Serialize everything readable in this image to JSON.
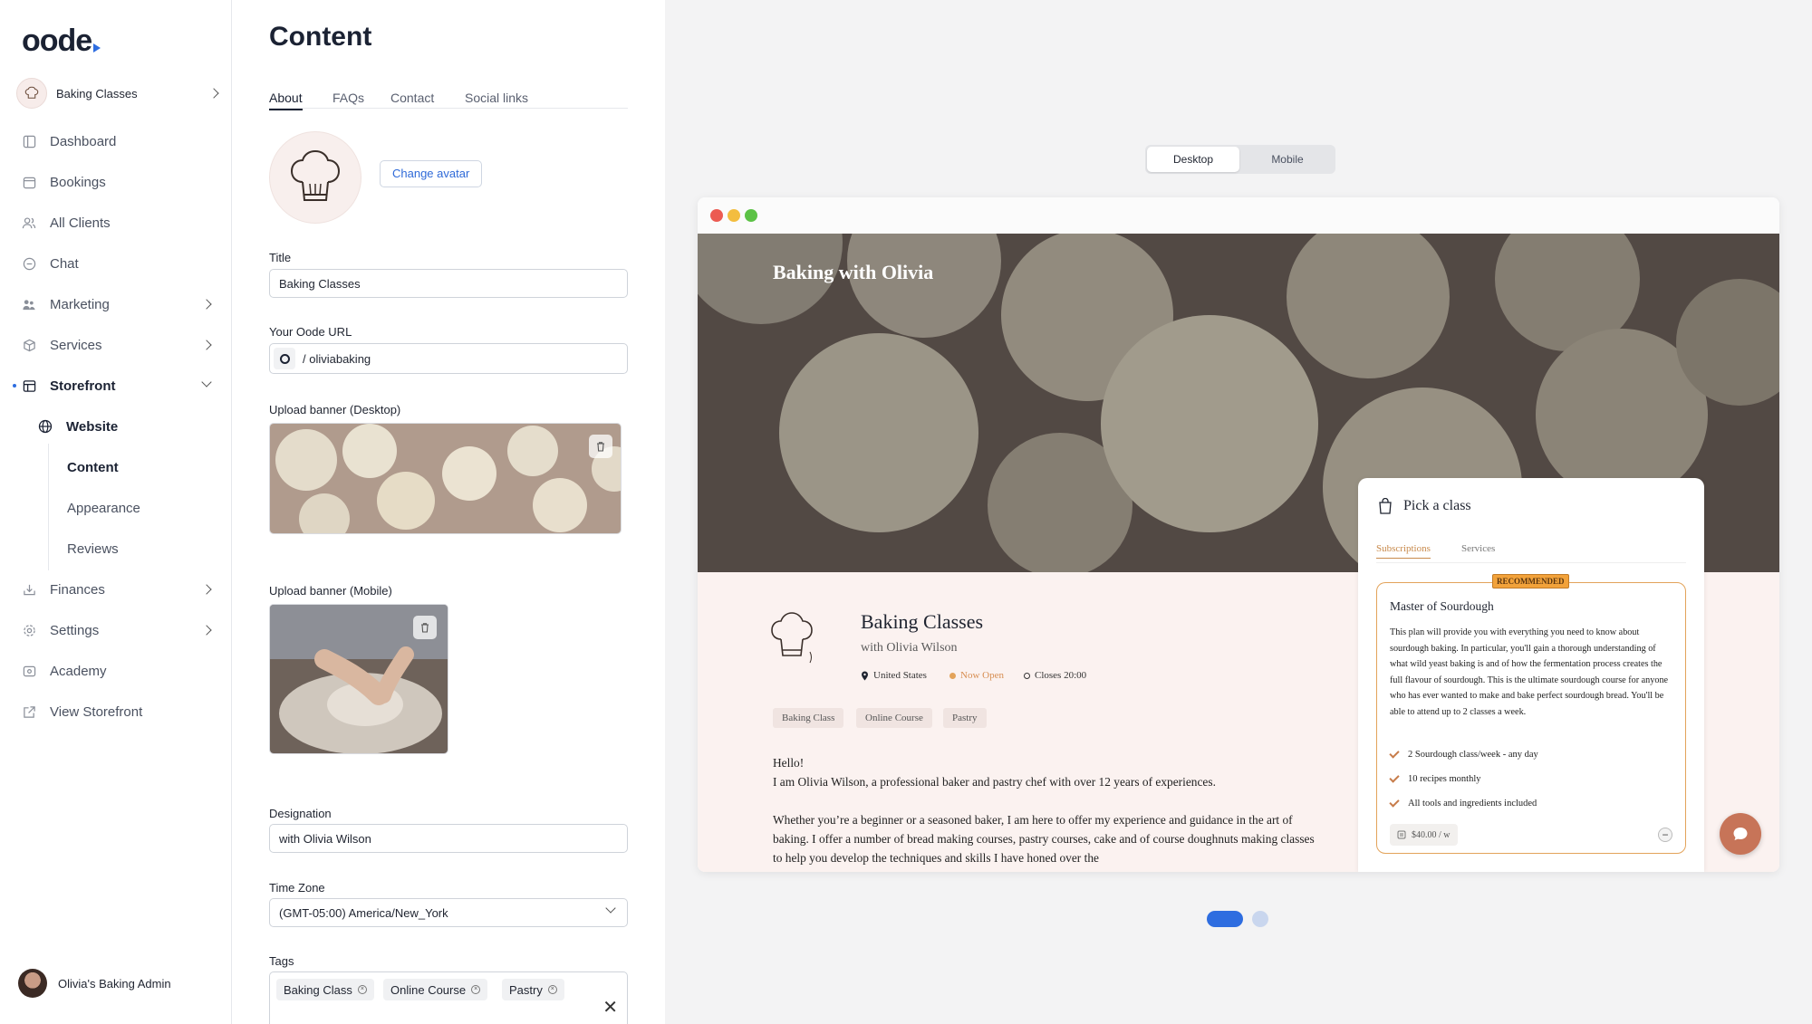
{
  "brand": {
    "logo_text": "oode",
    "accent": "#2e6de0"
  },
  "sidebar": {
    "business_name": "Baking Classes",
    "items": [
      {
        "label": "Dashboard",
        "icon": "dashboard-icon"
      },
      {
        "label": "Bookings",
        "icon": "calendar-icon"
      },
      {
        "label": "All Clients",
        "icon": "users-icon"
      },
      {
        "label": "Chat",
        "icon": "chat-icon"
      },
      {
        "label": "Marketing",
        "icon": "megaphone-icon"
      },
      {
        "label": "Services",
        "icon": "box-icon"
      },
      {
        "label": "Storefront",
        "icon": "storefront-icon"
      },
      {
        "label": "Finances",
        "icon": "wallet-icon"
      },
      {
        "label": "Settings",
        "icon": "gear-icon"
      },
      {
        "label": "Academy",
        "icon": "academy-icon"
      },
      {
        "label": "View Storefront",
        "icon": "external-link-icon"
      }
    ],
    "storefront_sub": {
      "website": "Website",
      "content": "Content",
      "appearance": "Appearance",
      "reviews": "Reviews"
    },
    "admin_name": "Olivia's Baking Admin"
  },
  "editor": {
    "title": "Content",
    "tabs": [
      "About",
      "FAQs",
      "Contact",
      "Social links"
    ],
    "change_avatar": "Change avatar",
    "title_label": "Title",
    "title_value": "Baking Classes",
    "url_label": "Your Oode URL",
    "url_value": "/ oliviabaking",
    "banner_desktop_label": "Upload banner (Desktop)",
    "banner_mobile_label": "Upload banner (Mobile)",
    "designation_label": "Designation",
    "designation_value": "with Olivia Wilson",
    "timezone_label": "Time Zone",
    "timezone_value": "(GMT-05:00) America/New_York",
    "tags_label": "Tags",
    "tags": [
      "Baking Class",
      "Online Course",
      "Pastry"
    ]
  },
  "preview": {
    "toggle": [
      "Desktop",
      "Mobile"
    ],
    "hero_title": "Baking with Olivia",
    "biz_title": "Baking Classes",
    "biz_sub": "with Olivia Wilson",
    "location": "United States",
    "status": "Now Open",
    "closes": "Closes 20:00",
    "tags": [
      "Baking Class",
      "Online Course",
      "Pastry"
    ],
    "greeting": "Hello!",
    "intro": "I am Olivia Wilson, a professional baker and pastry chef with over 12 years of experiences.",
    "paragraph": "Whether you’re a beginner or a seasoned baker, I am here to offer my experience and guidance in the art of baking. I offer a number of bread making courses, pastry courses, cake and of course doughnuts making classes to help you develop the techniques and skills I have honed over the",
    "card": {
      "heading": "Pick a class",
      "tabs": [
        "Subscriptions",
        "Services"
      ],
      "badge": "RECOMMENDED",
      "plan_name": "Master of Sourdough",
      "plan_desc": "This plan will provide you with everything you need to know about sourdough baking. In particular, you'll gain a thorough understanding of what wild yeast baking is and of how the fermentation process creates the full flavour of sourdough. This is the ultimate sourdough course for anyone who has ever wanted to make and bake perfect sourdough bread. You'll be able to attend up to 2 classes a week.",
      "features": [
        "2 Sourdough class/week - any day",
        "10 recipes monthly",
        "All tools and ingredients included"
      ],
      "price": "$40.00 / w"
    }
  }
}
